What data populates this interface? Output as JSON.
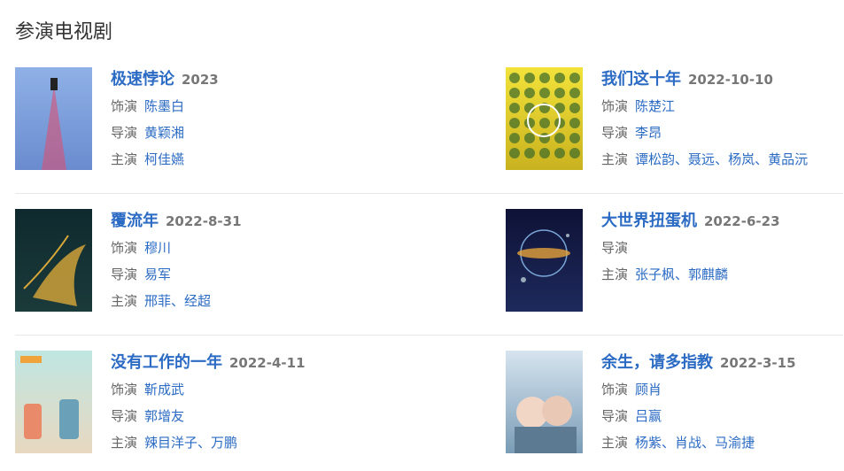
{
  "section": {
    "title": "参演电视剧"
  },
  "labels": {
    "role": "饰演",
    "director": "导演",
    "starring": "主演",
    "list_separator": "、"
  },
  "dramas": [
    {
      "title": "极速悖论",
      "date": "2023",
      "role": [
        "陈墨白"
      ],
      "director": [
        "黄颖湘"
      ],
      "starring": [
        "柯佳嬿"
      ],
      "poster": {
        "top": "#8fb0e6",
        "bottom": "#6a8ccf",
        "accent": "#e24a6a",
        "caption": "极速悖论"
      }
    },
    {
      "title": "我们这十年",
      "date": "2022-10-10",
      "role": [
        "陈楚江"
      ],
      "director": [
        "李昂"
      ],
      "starring": [
        "谭松韵",
        "聂远",
        "杨岚",
        "黄品沅"
      ],
      "poster": {
        "top": "#f2e23a",
        "bottom": "#c9b21f",
        "accent": "#3a6a2a",
        "caption": "我们这十年"
      }
    },
    {
      "title": "覆流年",
      "date": "2022-8-31",
      "role": [
        "穆川"
      ],
      "director": [
        "易军"
      ],
      "starring": [
        "邢菲",
        "经超"
      ],
      "poster": {
        "top": "#0f2a2e",
        "bottom": "#1b3a3a",
        "accent": "#d9a83a",
        "caption": "覆流年"
      }
    },
    {
      "title": "大世界扭蛋机",
      "date": "2022-6-23",
      "role": [],
      "director": [],
      "starring": [
        "张子枫",
        "郭麒麟"
      ],
      "poster": {
        "top": "#0e1236",
        "bottom": "#1e2a5c",
        "accent": "#e3a23b",
        "caption": "大世界扭蛋机"
      }
    },
    {
      "title": "没有工作的一年",
      "date": "2022-4-11",
      "role": [
        "靳成武"
      ],
      "director": [
        "郭增友"
      ],
      "starring": [
        "辣目洋子",
        "万鹏"
      ],
      "poster": {
        "top": "#bfe6e2",
        "bottom": "#e8d8c0",
        "accent": "#f0a33a",
        "caption": "没有工作的一年"
      }
    },
    {
      "title": "余生，请多指教",
      "date": "2022-3-15",
      "role": [
        "顾肖"
      ],
      "director": [
        "吕赢"
      ],
      "starring": [
        "杨紫",
        "肖战",
        "马渝捷"
      ],
      "poster": {
        "top": "#d6e4ef",
        "bottom": "#7a9cb6",
        "accent": "#c9a24a",
        "caption": "余生请多指教"
      }
    }
  ]
}
